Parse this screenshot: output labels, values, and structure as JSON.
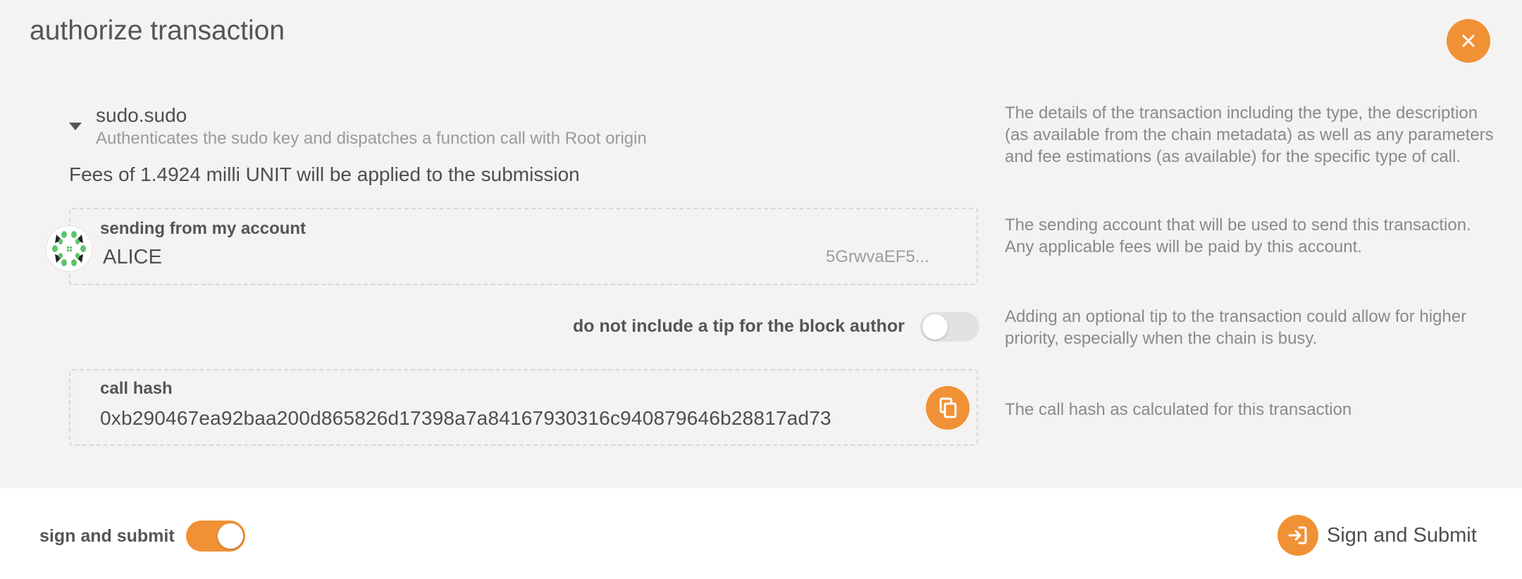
{
  "dialog": {
    "title": "authorize transaction",
    "close_icon": "close-icon"
  },
  "call": {
    "name": "sudo.sudo",
    "description": "Authenticates the sudo key and dispatches a function call with Root origin",
    "fees": "Fees of 1.4924 milli UNIT will be applied to the submission"
  },
  "help": {
    "call": "The details of the transaction including the type, the description (as available from the chain metadata) as well as any parameters and fee estimations (as available) for the specific type of call.",
    "account": "The sending account that will be used to send this transaction. Any applicable fees will be paid by this account.",
    "tip": "Adding an optional tip to the transaction could allow for higher priority, especially when the chain is busy.",
    "hash": "The call hash as calculated for this transaction"
  },
  "account": {
    "label": "sending from my account",
    "name": "ALICE",
    "address": "5GrwvaEF5..."
  },
  "tip": {
    "label": "do not include a tip for the block author",
    "enabled": false
  },
  "hash": {
    "label": "call hash",
    "value": "0xb290467ea92baa200d865826d17398a7a84167930316c940879646b28817ad73"
  },
  "footer": {
    "sign_label": "sign and submit",
    "sign_enabled": true,
    "submit_label": "Sign and Submit"
  },
  "colors": {
    "accent": "#f19135",
    "toggle_off": "#e2e2e2",
    "background": "#f4f3f2"
  }
}
